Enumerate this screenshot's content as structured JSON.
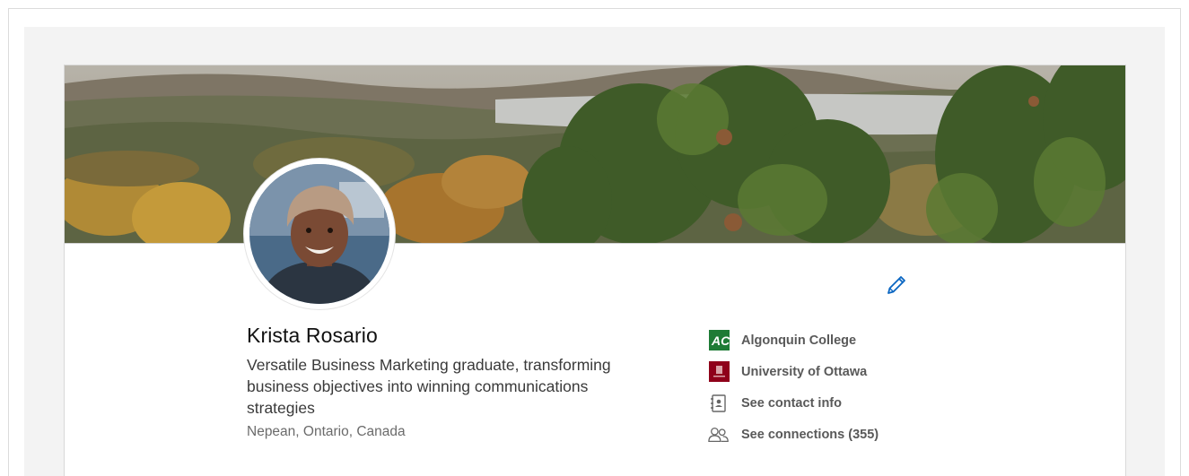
{
  "profile": {
    "name": "Krista Rosario",
    "headline": "Versatile Business Marketing graduate, transforming business objectives into winning communications strategies",
    "location": "Nepean, Ontario, Canada"
  },
  "side": {
    "education_1": "Algonquin College",
    "education_2": "University of Ottawa",
    "contact": "See contact info",
    "connections": "See connections (355)"
  },
  "icons": {
    "edit": "pencil-icon",
    "algonquin": "algonquin-college-logo",
    "uottawa": "university-of-ottawa-logo",
    "contact": "contact-card-icon",
    "connections": "people-icon"
  },
  "colors": {
    "accent": "#0a66c2",
    "algonquin_green": "#1e7b35",
    "uottawa_red": "#8f001a"
  }
}
